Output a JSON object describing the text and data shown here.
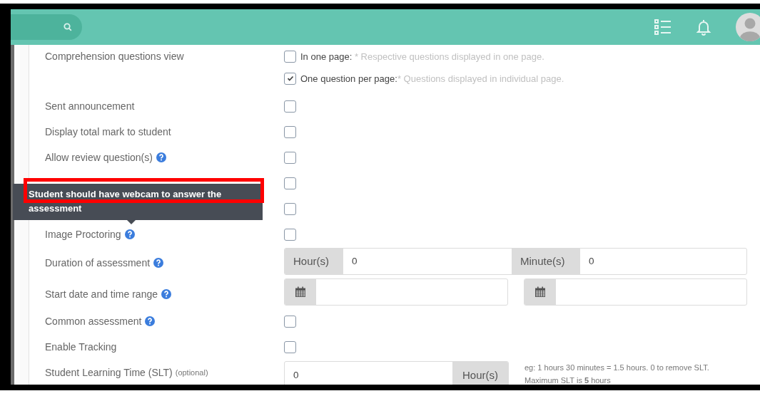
{
  "rows": [
    {
      "kind": "options",
      "label": "Comprehension questions view",
      "help": false,
      "options": [
        {
          "title": "In one page:",
          "note": " * Respective questions displayed in one page.",
          "checked": false
        },
        {
          "title": "One question per page:",
          "note": "* Questions displayed in individual page.",
          "checked": true
        }
      ]
    },
    {
      "kind": "checkbox",
      "label": "Sent announcement",
      "help": false,
      "checked": false
    },
    {
      "kind": "checkbox",
      "label": "Display total mark to student",
      "help": false,
      "checked": false
    },
    {
      "kind": "checkbox",
      "label": "Allow review question(s)",
      "help": true,
      "checked": false
    },
    {
      "kind": "checkbox",
      "help": false,
      "checked": false
    },
    {
      "kind": "checkbox",
      "help": false,
      "checked": false
    },
    {
      "kind": "checkbox",
      "label": "Image Proctoring",
      "help": true,
      "checked": false
    },
    {
      "kind": "duration",
      "label": "Duration of assessment",
      "help": true,
      "hours_label": "Hour(s)",
      "hours": "0",
      "minutes_label": "Minute(s)",
      "minutes": "0"
    },
    {
      "kind": "daterange",
      "label": "Start date and time range",
      "help": true
    },
    {
      "kind": "checkbox",
      "label": "Common assessment",
      "help": true,
      "checked": false
    },
    {
      "kind": "checkbox",
      "label": "Enable Tracking",
      "help": false,
      "checked": false
    },
    {
      "kind": "slt",
      "label": "Student Learning Time (SLT)",
      "optional": "(optional)",
      "help": false,
      "value": "0",
      "unit": "Hour(s)",
      "hint": "eg: 1 hours 30 minutes = 1.5 hours. 0 to remove SLT.",
      "max": "Maximum SLT is **5** hours"
    }
  ],
  "tooltip": {
    "text": "Student should have webcam to answer the assessment"
  }
}
